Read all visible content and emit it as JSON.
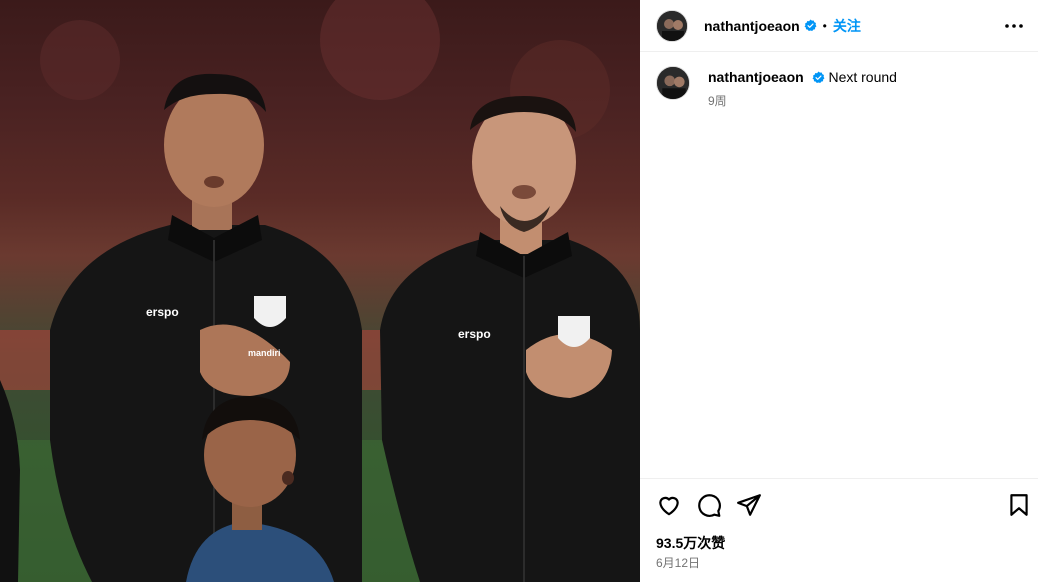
{
  "post": {
    "username": "nathantjoeaon",
    "follow_label": "关注",
    "separator": "•",
    "caption_text": "Next round",
    "caption_time": "9周",
    "likes": "93.5万次赞",
    "date": "6月12日"
  },
  "photo": {
    "jersey_brand_left": "erspo",
    "jersey_brand_right": "erspo",
    "sponsor": "mandiri"
  },
  "icons": {
    "verified": "verified-badge-icon",
    "more": "more-options-icon",
    "like": "heart-icon",
    "comment": "comment-icon",
    "share": "share-icon",
    "save": "bookmark-icon"
  },
  "colors": {
    "accent": "#0095f6",
    "verified": "#0095f6",
    "muted": "#737373"
  }
}
